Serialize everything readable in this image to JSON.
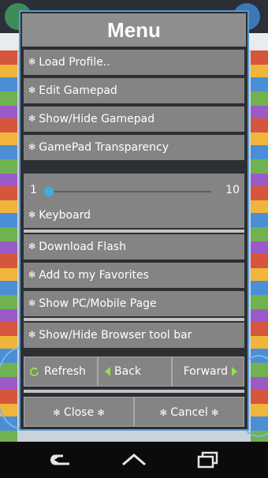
{
  "menu": {
    "title": "Menu",
    "items_a": [
      "Load Profile..",
      "Edit Gamepad",
      "Show/Hide Gamepad",
      "GamePad Transparency"
    ],
    "slider": {
      "min_label": "1",
      "max_label": "10",
      "value": 1,
      "min": 1,
      "max": 10
    },
    "keyboard": "Keyboard",
    "items_b": [
      "Download Flash",
      "Add to my Favorites",
      "Show PC/Mobile Page"
    ],
    "browser_toolbar": "Show/Hide Browser tool bar",
    "refresh": "Refresh",
    "back": "Back",
    "forward": "Forward",
    "close": "Close",
    "cancel": "Cancel"
  },
  "icons": {
    "bullet": "✻",
    "refresh": "refresh-icon",
    "back": "back-arrow-icon",
    "forward": "forward-arrow-icon"
  },
  "colors": {
    "accent": "#3cb2ea",
    "dialog_border": "#5b98cf",
    "arrow": "#8fe24a"
  }
}
